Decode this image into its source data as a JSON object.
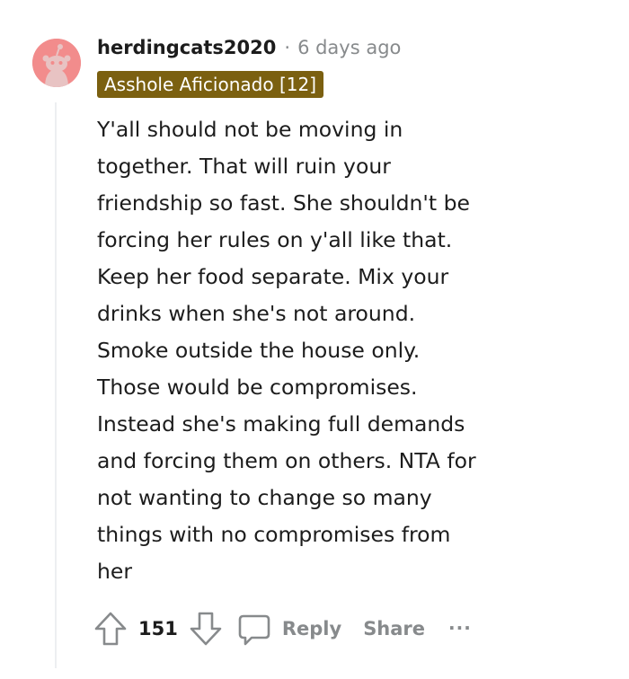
{
  "comment": {
    "author": "herdingcats2020",
    "separator": "·",
    "timestamp": "6 days ago",
    "flair": "Asshole Aficionado [12]",
    "body_lines": [
      "Y'all should not be moving in",
      "together. That will ruin your",
      "friendship so fast. She shouldn't be",
      "forcing her rules on y'all like that.",
      "Keep her food separate. Mix your",
      "drinks when she's not around.",
      "Smoke outside the house only.",
      "Those would be compromises.",
      "Instead she's making full demands",
      "and forcing them on others. NTA for",
      "not wanting to change so many",
      "things with no compromises from",
      "her"
    ]
  },
  "actions": {
    "vote_count": "151",
    "reply_label": "Reply",
    "share_label": "Share",
    "more_label": "..."
  },
  "icons": {
    "avatar": "snoo-avatar-icon",
    "upvote": "upvote-arrow-icon",
    "downvote": "downvote-arrow-icon",
    "reply": "comment-bubble-icon",
    "more": "more-options-icon"
  },
  "colors": {
    "avatar_background": "#f28c8c",
    "flair_background": "#7b6010",
    "flair_text": "#ffffff",
    "muted_text": "#878a8c",
    "body_text": "#1c1c1c",
    "thread_line": "#edeff1"
  }
}
